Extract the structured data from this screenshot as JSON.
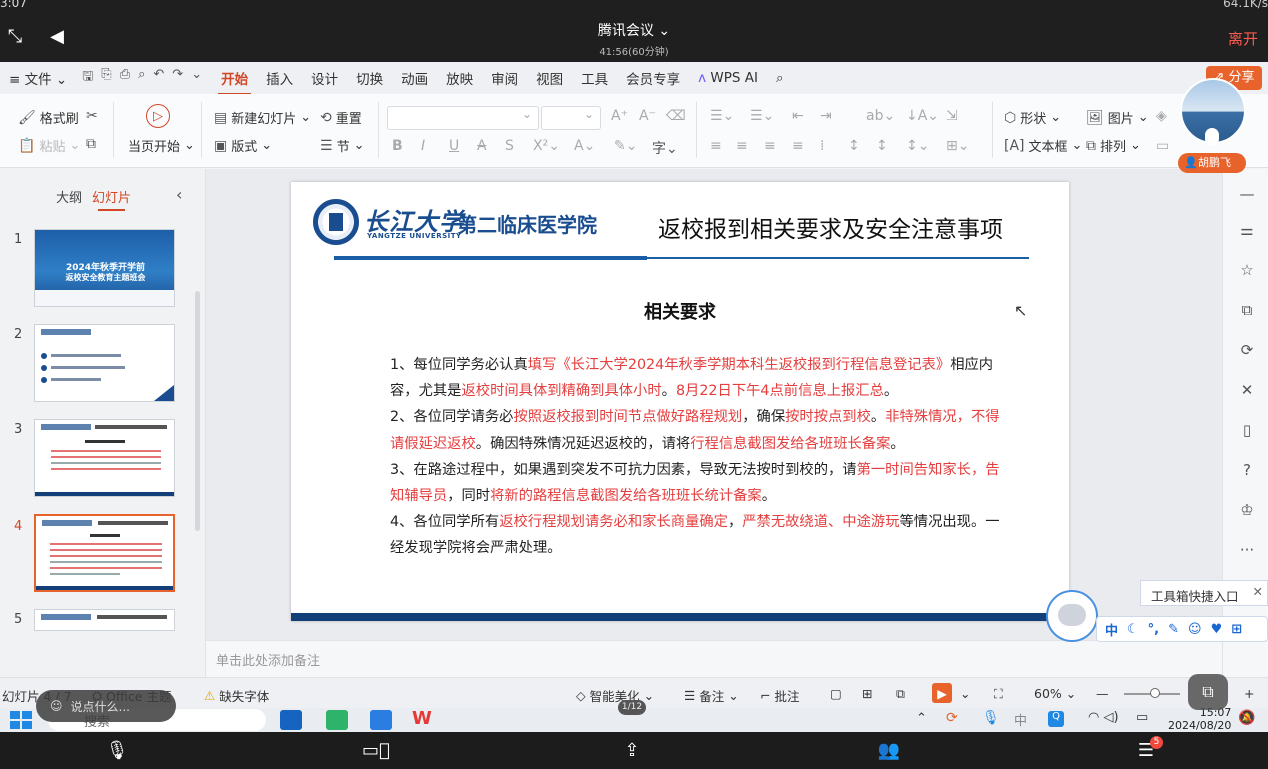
{
  "meeting": {
    "time": "3:07",
    "net_speed": "64.1K/s",
    "title": "腾讯会议",
    "duration": "41:56(60分钟)",
    "leave_label": "离开",
    "participant_name": "胡鹏飞",
    "chat_placeholder": "说点什么...",
    "page_indicator": "1/12",
    "badge_count": "5"
  },
  "menubar": {
    "file": "文件",
    "tabs": [
      "开始",
      "插入",
      "设计",
      "切换",
      "动画",
      "放映",
      "审阅",
      "视图",
      "工具",
      "会员专享",
      "WPS AI"
    ],
    "active_tab": "开始",
    "share": "分享"
  },
  "ribbon": {
    "format_painter": "格式刷",
    "paste": "粘贴",
    "play_current": "当页开始",
    "new_slide": "新建幻灯片",
    "reset": "重置",
    "layout": "版式",
    "section": "节",
    "shape": "形状",
    "picture": "图片",
    "textbox": "文本框",
    "arrange": "排列"
  },
  "left_panel": {
    "tab_outline": "大纲",
    "tab_slides": "幻灯片",
    "thumb1_title": "2024年秋季开学前",
    "thumb1_subtitle": "返校安全教育主题班会",
    "slide_numbers": [
      "1",
      "2",
      "3",
      "4",
      "5"
    ],
    "selected": 4
  },
  "slide": {
    "logo_cn": "长江大学",
    "logo_en": "YANGTZE UNIVERSITY",
    "college": "第二临床医学院",
    "title": "返校报到相关要求及安全注意事项",
    "heading": "相关要求",
    "p1": [
      {
        "t": "1、每位同学务必认真",
        "red": false
      },
      {
        "t": "填写《长江大学2024年秋季学期本科生返校报到行程信息登记表》",
        "red": true
      },
      {
        "t": "相应内容，尤其是",
        "red": false
      },
      {
        "t": "返校时间具体到精确到具体小时",
        "red": true
      },
      {
        "t": "。",
        "red": false
      },
      {
        "t": "8月22日下午4点前信息上报汇总",
        "red": true
      },
      {
        "t": "。",
        "red": false
      }
    ],
    "p2": [
      {
        "t": "2、各位同学请务必",
        "red": false
      },
      {
        "t": "按照返校报到时间节点做好路程规划",
        "red": true
      },
      {
        "t": "，确保",
        "red": false
      },
      {
        "t": "按时按点到校",
        "red": true
      },
      {
        "t": "。",
        "red": false
      },
      {
        "t": "非特殊情况，不得请假延迟返校",
        "red": true
      },
      {
        "t": "。确因特殊情况延迟返校的，请将",
        "red": false
      },
      {
        "t": "行程信息截图发给各班班长备案",
        "red": true
      },
      {
        "t": "。",
        "red": false
      }
    ],
    "p3": [
      {
        "t": "3、在路途过程中，如果遇到突发不可抗力因素，导致无法按时到校的，请",
        "red": false
      },
      {
        "t": "第一时间告知家长，告知辅导员",
        "red": true
      },
      {
        "t": "，同时",
        "red": false
      },
      {
        "t": "将新的路程信息截图发给各班班长统计备案",
        "red": true
      },
      {
        "t": "。",
        "red": false
      }
    ],
    "p4": [
      {
        "t": "4、各位同学所有",
        "red": false
      },
      {
        "t": "返校行程规划请务必和家长商量确定",
        "red": true
      },
      {
        "t": "，",
        "red": false
      },
      {
        "t": "严禁无故绕道、中途游玩",
        "red": true
      },
      {
        "t": "等情况出现。一经发现学院将会严肃处理。",
        "red": false
      }
    ]
  },
  "notes_placeholder": "单击此处添加备注",
  "statusbar": {
    "slide_info": "幻灯片 4 / 7",
    "theme": "Office 主题",
    "missing_font": "缺失字体",
    "beautify": "智能美化",
    "notes": "备注",
    "comments": "批注",
    "zoom": "60%"
  },
  "ime": {
    "tip": "工具箱快捷入口",
    "mode": "中"
  },
  "taskbar": {
    "search": "搜索",
    "clock_time": "15:07",
    "clock_date": "2024/08/20"
  },
  "colors": {
    "accent": "#d24726",
    "share": "#e8622c",
    "slide_blue": "#1a4d8f",
    "highlight_red": "#e53e3e",
    "leave_red": "#ff5a4e"
  }
}
